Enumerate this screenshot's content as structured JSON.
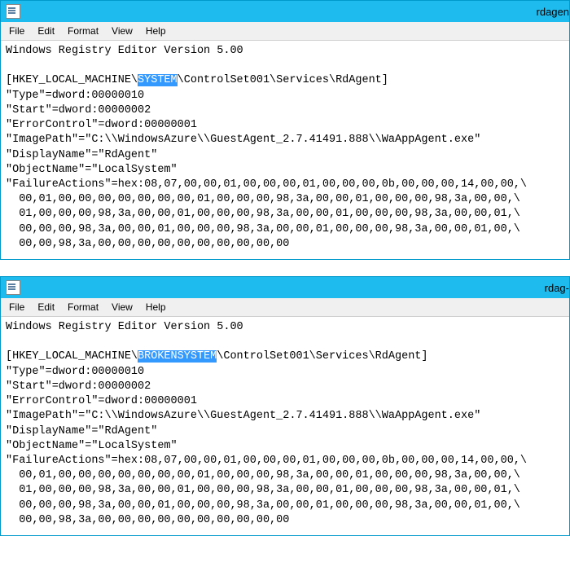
{
  "windows": [
    {
      "title_visible": "rdagen",
      "menu": [
        "File",
        "Edit",
        "Format",
        "View",
        "Help"
      ],
      "header_line": "Windows Registry Editor Version 5.00",
      "key_prefix": "[HKEY_LOCAL_MACHINE\\",
      "key_highlight": "SYSTEM",
      "key_suffix": "\\ControlSet001\\Services\\RdAgent]",
      "value_lines": [
        "\"Type\"=dword:00000010",
        "\"Start\"=dword:00000002",
        "\"ErrorControl\"=dword:00000001",
        "\"ImagePath\"=\"C:\\\\WindowsAzure\\\\GuestAgent_2.7.41491.888\\\\WaAppAgent.exe\"",
        "\"DisplayName\"=\"RdAgent\"",
        "\"ObjectName\"=\"LocalSystem\"",
        "\"FailureActions\"=hex:08,07,00,00,01,00,00,00,01,00,00,00,0b,00,00,00,14,00,00,\\",
        "  00,01,00,00,00,00,00,00,00,01,00,00,00,98,3a,00,00,01,00,00,00,98,3a,00,00,\\",
        "  01,00,00,00,98,3a,00,00,01,00,00,00,98,3a,00,00,01,00,00,00,98,3a,00,00,01,\\",
        "  00,00,00,98,3a,00,00,01,00,00,00,98,3a,00,00,01,00,00,00,98,3a,00,00,01,00,\\",
        "  00,00,98,3a,00,00,00,00,00,00,00,00,00,00"
      ]
    },
    {
      "title_visible": "rdag- ",
      "menu": [
        "File",
        "Edit",
        "Format",
        "View",
        "Help"
      ],
      "header_line": "Windows Registry Editor Version 5.00",
      "key_prefix": "[HKEY_LOCAL_MACHINE\\",
      "key_highlight": "BROKENSYSTEM",
      "key_suffix": "\\ControlSet001\\Services\\RdAgent]",
      "value_lines": [
        "\"Type\"=dword:00000010",
        "\"Start\"=dword:00000002",
        "\"ErrorControl\"=dword:00000001",
        "\"ImagePath\"=\"C:\\\\WindowsAzure\\\\GuestAgent_2.7.41491.888\\\\WaAppAgent.exe\"",
        "\"DisplayName\"=\"RdAgent\"",
        "\"ObjectName\"=\"LocalSystem\"",
        "\"FailureActions\"=hex:08,07,00,00,01,00,00,00,01,00,00,00,0b,00,00,00,14,00,00,\\",
        "  00,01,00,00,00,00,00,00,00,01,00,00,00,98,3a,00,00,01,00,00,00,98,3a,00,00,\\",
        "  01,00,00,00,98,3a,00,00,01,00,00,00,98,3a,00,00,01,00,00,00,98,3a,00,00,01,\\",
        "  00,00,00,98,3a,00,00,01,00,00,00,98,3a,00,00,01,00,00,00,98,3a,00,00,01,00,\\",
        "  00,00,98,3a,00,00,00,00,00,00,00,00,00,00"
      ]
    }
  ]
}
